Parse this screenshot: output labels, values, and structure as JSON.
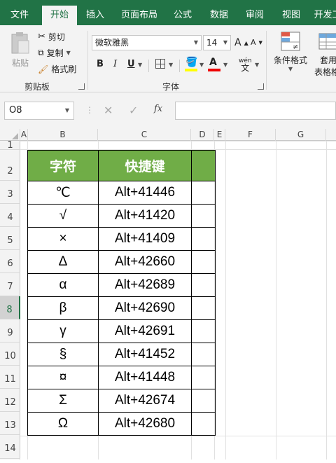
{
  "tabs": [
    "文件",
    "开始",
    "插入",
    "页面布局",
    "公式",
    "数据",
    "审阅",
    "视图",
    "开发工"
  ],
  "clipboard": {
    "paste": "粘贴",
    "cut": "剪切",
    "copy": "复制",
    "format_painter": "格式刷",
    "group_label": "剪贴板"
  },
  "font": {
    "name": "微软雅黑",
    "size": "14",
    "bold": "B",
    "italic": "I",
    "underline": "U",
    "grow": "A",
    "shrink": "A",
    "phonetic": "wén",
    "group_label": "字体"
  },
  "styles": {
    "conditional": "条件格式",
    "table_line1": "套用",
    "table_line2": "表格格"
  },
  "formula_bar": {
    "name_box": "O8",
    "cancel": "✕",
    "enter": "✓",
    "fx": "fx",
    "value": ""
  },
  "columns": [
    "A",
    "B",
    "C",
    "D",
    "E",
    "F",
    "G"
  ],
  "rows": [
    "1",
    "2",
    "3",
    "4",
    "5",
    "6",
    "7",
    "8",
    "9",
    "10",
    "11",
    "12",
    "13",
    "14"
  ],
  "table": {
    "headers": [
      "字符",
      "快捷键",
      ""
    ],
    "rows": [
      [
        "℃",
        "Alt+41446"
      ],
      [
        "√",
        "Alt+41420"
      ],
      [
        "×",
        "Alt+41409"
      ],
      [
        "Δ",
        "Alt+42660"
      ],
      [
        "α",
        "Alt+42689"
      ],
      [
        "β",
        "Alt+42690"
      ],
      [
        "γ",
        "Alt+42691"
      ],
      [
        "§",
        "Alt+41452"
      ],
      [
        "¤",
        "Alt+41448"
      ],
      [
        "Σ",
        "Alt+42674"
      ],
      [
        "Ω",
        "Alt+42680"
      ]
    ]
  },
  "colors": {
    "excel_green": "#217346",
    "header_fill": "#70ad47"
  }
}
